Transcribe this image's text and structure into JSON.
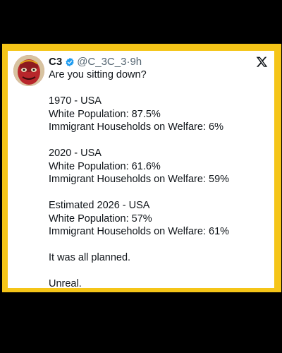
{
  "colors": {
    "frame": "#f5c518",
    "background": "#000000",
    "card": "#ffffff",
    "verified": "#1d9bf0",
    "text": "#0f1419",
    "muted": "#536471"
  },
  "tweet": {
    "display_name": "C3",
    "verified_icon": "verified-badge-icon",
    "handle": "@C_3C_3",
    "separator": "·",
    "time": "9h",
    "platform_icon": "x-logo-icon",
    "lines": [
      "Are you sitting down?",
      "",
      "1970 - USA",
      "White Population: 87.5%",
      "Immigrant Households on Welfare: 6%",
      "",
      "2020 - USA",
      "White Population: 61.6%",
      "Immigrant Households on Welfare: 59%",
      "",
      "Estimated 2026 - USA",
      "White Population: 57%",
      "Immigrant Households on Welfare: 61%",
      "",
      "It was all planned.",
      "",
      "Unreal."
    ]
  }
}
